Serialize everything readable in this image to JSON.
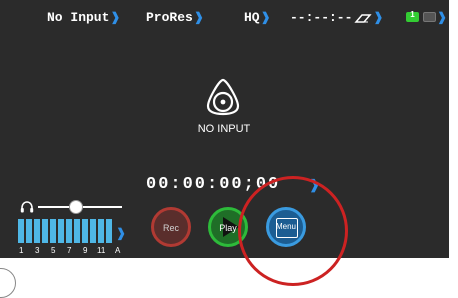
{
  "status_bar": {
    "input_label": "No Input",
    "codec_label": "ProRes",
    "quality_label": "HQ",
    "time_remaining": "--:--:--",
    "battery_1_number": "1",
    "colors": {
      "chevron": "#2f8fe6",
      "battery_active": "#33cc33"
    }
  },
  "center": {
    "logo_icon": "atomos-logo-icon",
    "message": "NO INPUT"
  },
  "timecode": {
    "value": "00:00:00;00"
  },
  "headphone": {
    "icon": "headphones-icon",
    "volume_level": 0.45
  },
  "audio_meters": {
    "channel_labels": [
      "1",
      "3",
      "5",
      "7",
      "9",
      "11",
      "A"
    ]
  },
  "buttons": {
    "rec_label": "Rec",
    "play_label": "Play",
    "menu_label": "Menu"
  },
  "annotation": {
    "highlight_color": "#cc2222"
  }
}
